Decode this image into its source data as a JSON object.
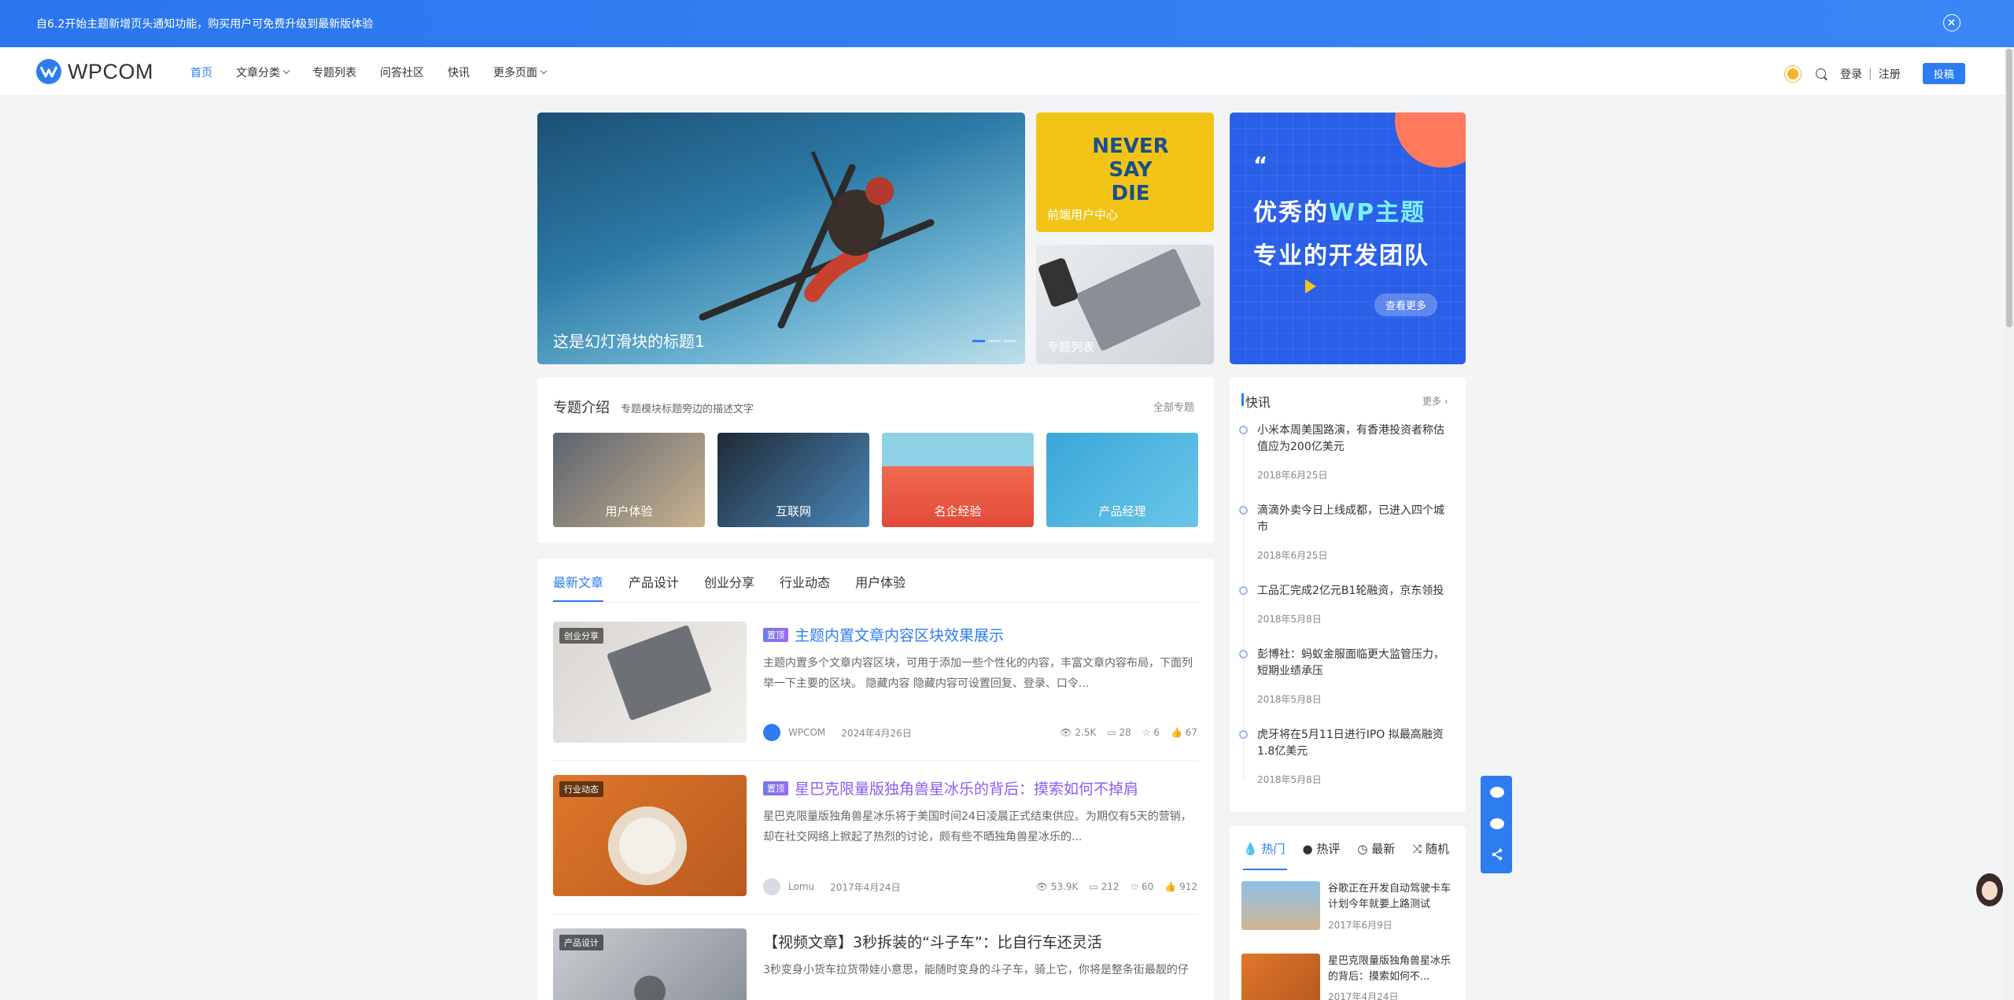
{
  "notice": {
    "text": "自6.2开始主题新增页头通知功能，购买用户可免费升级到最新版体验"
  },
  "header": {
    "logo": "WPCOM",
    "nav": [
      {
        "label": "首页",
        "active": true
      },
      {
        "label": "文章分类",
        "dropdown": true
      },
      {
        "label": "专题列表"
      },
      {
        "label": "问答社区"
      },
      {
        "label": "快讯"
      },
      {
        "label": "更多页面",
        "dropdown": true
      }
    ],
    "login": "登录",
    "register": "注册",
    "post": "投稿"
  },
  "hero": {
    "slide_title": "这是幻灯滑块的标题1",
    "mini1": "前端用户中心",
    "mini1_art": [
      "NEVER",
      "SAY",
      "DIE"
    ],
    "mini2": "专题列表",
    "banner": {
      "quote": "“",
      "line1_a": "优秀的",
      "line1_b": "WP主题",
      "line2": "专业的开发团队",
      "more": "查看更多"
    }
  },
  "topics": {
    "title": "专题介绍",
    "desc": "专题模块标题旁边的描述文字",
    "all": "全部专题",
    "items": [
      "用户体验",
      "互联网",
      "名企经验",
      "产品经理"
    ]
  },
  "tabs": [
    "最新文章",
    "产品设计",
    "创业分享",
    "行业动态",
    "用户体验"
  ],
  "articles": [
    {
      "category": "创业分享",
      "top": "置顶",
      "title": "主题内置文章内容区块效果展示",
      "desc": "主题内置多个文章内容区块，可用于添加一些个性化的内容，丰富文章内容布局，下面列举一下主要的区块。 隐藏内容 隐藏内容可设置回复、登录、口令...",
      "author": "WPCOM",
      "date": "2024年4月26日",
      "views": "2.5K",
      "comments": "28",
      "stars": "6",
      "likes": "67"
    },
    {
      "category": "行业动态",
      "top": "置顶",
      "title": "星巴克限量版独角兽星冰乐的背后：摸索如何不掉肩",
      "desc": "星巴克限量版独角兽星冰乐将于美国时间24日凌晨正式结束供应。为期仅有5天的营销，却在社交网络上掀起了热烈的讨论，颇有些不晒独角兽星冰乐的...",
      "author": "Lomu",
      "date": "2017年4月24日",
      "views": "53.9K",
      "comments": "212",
      "stars": "60",
      "likes": "912"
    },
    {
      "category": "产品设计",
      "title": "【视频文章】3秒拆装的“斗子车”：比自行车还灵活",
      "desc": "3秒变身小货车拉货带娃小意思，能随时变身的斗子车，骑上它，你将是整条街最靓的仔"
    }
  ],
  "flash": {
    "title": "快讯",
    "more": "更多",
    "items": [
      {
        "text": "小米本周美国路演，有香港投资者称估值应为200亿美元",
        "date": "2018年6月25日"
      },
      {
        "text": "滴滴外卖今日上线成都，已进入四个城市",
        "date": "2018年6月25日"
      },
      {
        "text": "工品汇完成2亿元B1轮融资，京东领投",
        "date": "2018年5月8日"
      },
      {
        "text": "彭博社：蚂蚁金服面临更大监管压力，短期业绩承压",
        "date": "2018年5月8日"
      },
      {
        "text": "虎牙将在5月11日进行IPO 拟最高融资1.8亿美元",
        "date": "2018年5月8日"
      }
    ]
  },
  "hot": {
    "tabs": [
      "热门",
      "热评",
      "最新",
      "随机"
    ],
    "items": [
      {
        "title": "谷歌正在开发自动驾驶卡车 计划今年就要上路测试",
        "date": "2017年6月9日"
      },
      {
        "title": "星巴克限量版独角兽星冰乐的背后：摸索如何不...",
        "date": "2017年4月24日"
      }
    ]
  }
}
